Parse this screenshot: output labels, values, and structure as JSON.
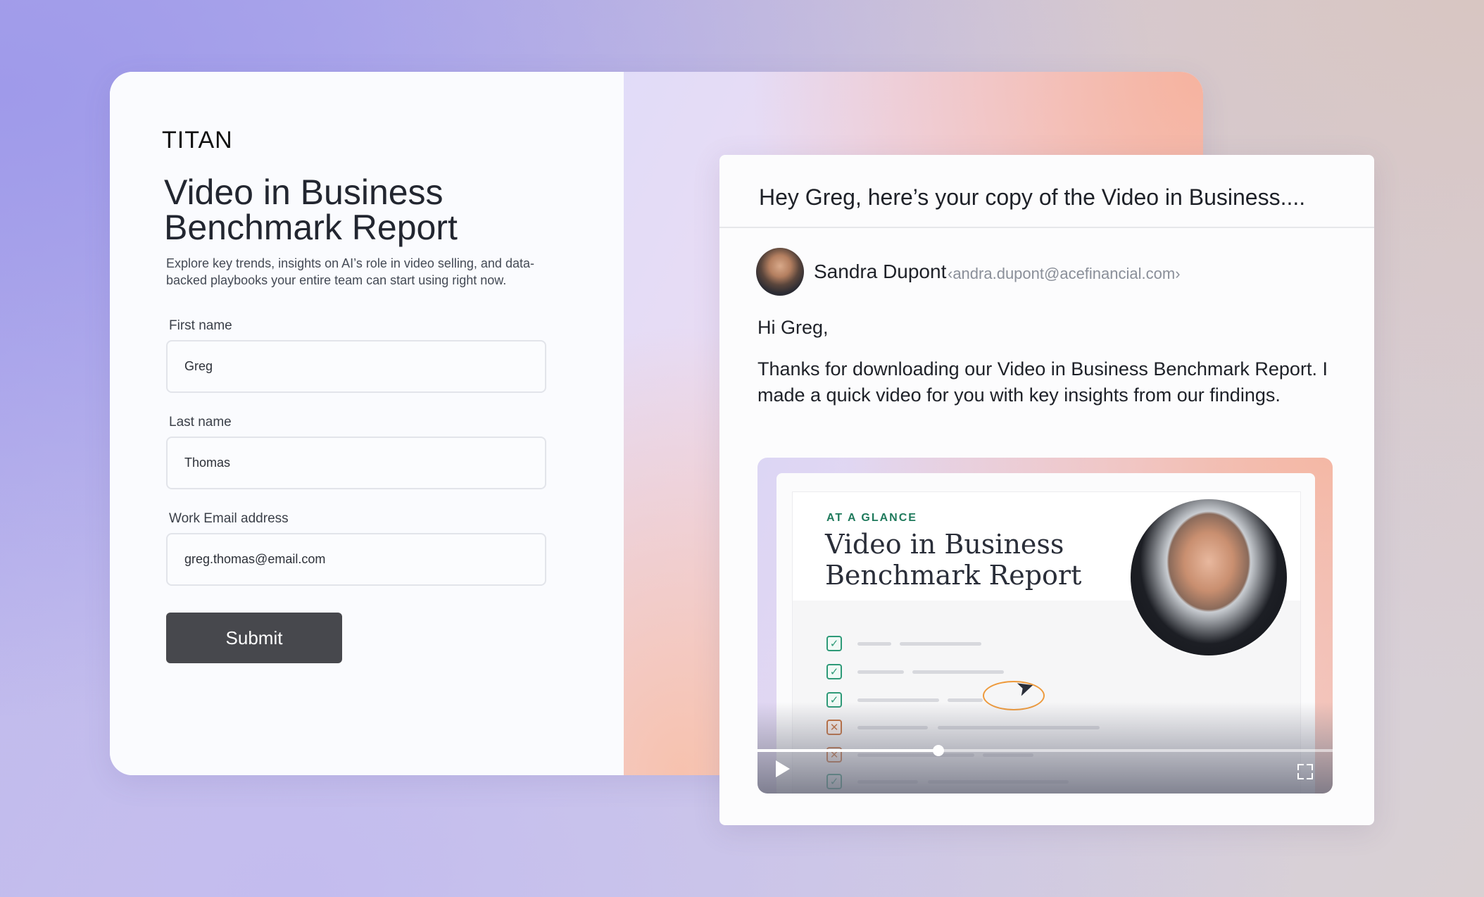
{
  "form": {
    "brand": "TITAN",
    "title": "Video in Business Benchmark Report",
    "subtitle": "Explore key trends, insights on AI’s role in video selling, and data-backed playbooks your entire team can start using right now.",
    "fields": [
      {
        "label": "First name",
        "value": "Greg"
      },
      {
        "label": "Last name",
        "value": "Thomas"
      },
      {
        "label": "Work Email address",
        "value": "greg.thomas@email.com"
      }
    ],
    "submit_label": "Submit"
  },
  "email": {
    "subject": "Hey Greg, here’s your copy of the Video in Business....",
    "sender_name": "Sandra Dupont",
    "sender_email": "‹andra.dupont@acefinancial.com›",
    "greeting": "Hi Greg,",
    "body": "Thanks for downloading our Video in Business Benchmark Report. I made a quick video for you with key insights from our findings."
  },
  "video": {
    "eyebrow": "AT A GLANCE",
    "title": "Video in Business Benchmark Report",
    "progress": 0.315,
    "checklist": [
      {
        "status": "check",
        "glyph": "✓"
      },
      {
        "status": "check",
        "glyph": "✓"
      },
      {
        "status": "check",
        "glyph": "✓"
      },
      {
        "status": "cross",
        "glyph": "✕"
      },
      {
        "status": "cross",
        "glyph": "✕"
      },
      {
        "status": "check",
        "glyph": "✓"
      }
    ],
    "icons": {
      "play": "play-icon",
      "fullscreen": "fullscreen-icon",
      "cursor": "cursor-icon"
    }
  },
  "colors": {
    "accent_green": "#2e9a78",
    "accent_orange": "#ee9a3c",
    "submit_bg": "#47484d"
  }
}
